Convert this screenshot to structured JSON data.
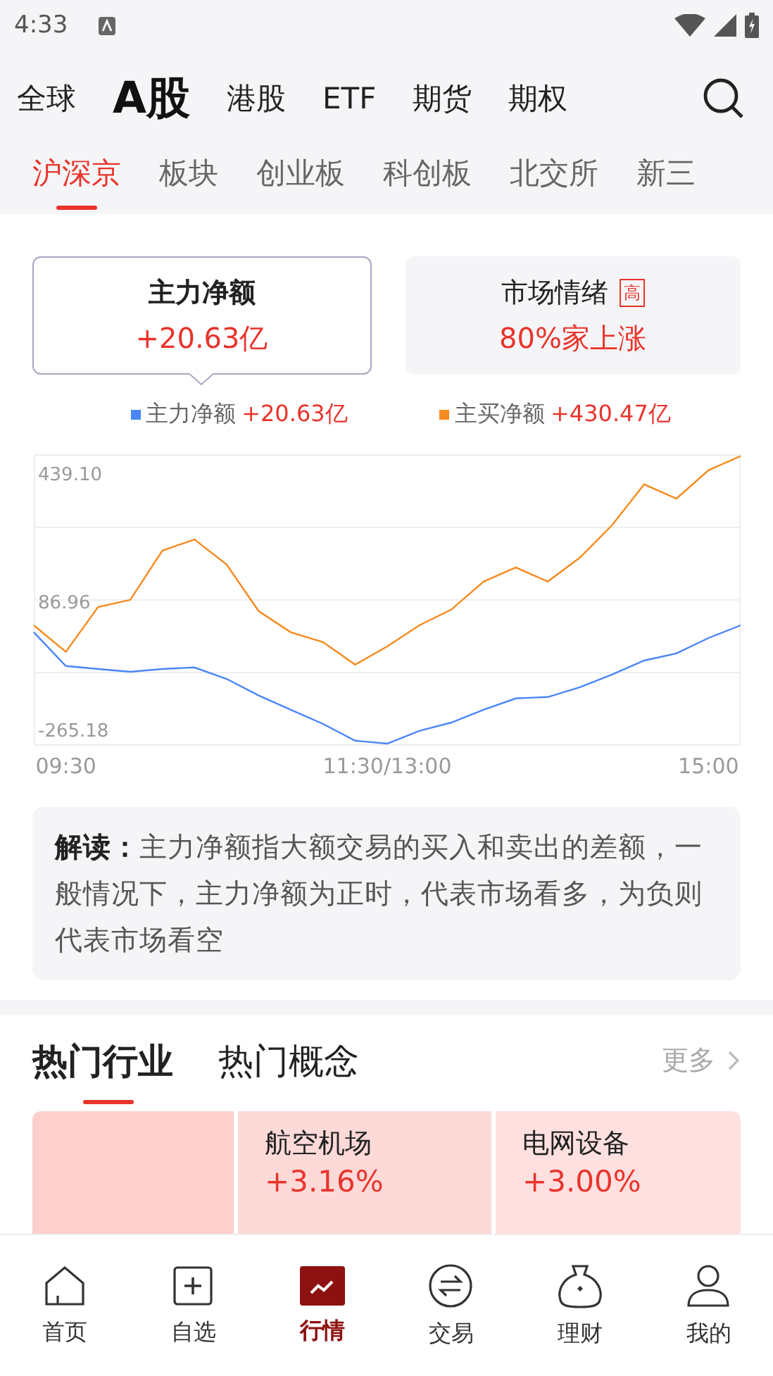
{
  "status_bar": {
    "time": "4:33"
  },
  "market_tabs": [
    {
      "label": "全球",
      "selected": false
    },
    {
      "label": "A股",
      "selected": true
    },
    {
      "label": "港股",
      "selected": false
    },
    {
      "label": "ETF",
      "selected": false
    },
    {
      "label": "期货",
      "selected": false
    },
    {
      "label": "期权",
      "selected": false
    }
  ],
  "sub_tabs": [
    {
      "label": "沪深京",
      "selected": true
    },
    {
      "label": "板块",
      "selected": false
    },
    {
      "label": "创业板",
      "selected": false
    },
    {
      "label": "科创板",
      "selected": false
    },
    {
      "label": "北交所",
      "selected": false
    },
    {
      "label": "新三",
      "selected": false
    }
  ],
  "overview_cards": [
    {
      "title": "主力净额",
      "value": "+20.63亿",
      "selected": true
    },
    {
      "title": "市场情绪",
      "badge": "高",
      "value": "80%家上涨",
      "selected": false
    }
  ],
  "legend_values": [
    "+20.63亿",
    "+430.47亿"
  ],
  "chart_data": {
    "type": "line",
    "categories": [
      null,
      "09:30",
      null,
      null,
      null,
      null,
      null,
      null,
      null,
      null,
      null,
      "11:30/13:00",
      null,
      null,
      null,
      null,
      null,
      null,
      null,
      null,
      null,
      "15:00",
      null
    ],
    "series": [
      {
        "name": "主力净额",
        "color": "#4a86f7",
        "values": [
          2,
          -91,
          -99,
          -107,
          -99,
          -95,
          -126,
          -172,
          -211,
          -250,
          -296,
          -304,
          -269,
          -246,
          -211,
          -180,
          -176,
          -149,
          -114,
          -76,
          -56,
          -14,
          21
        ]
      },
      {
        "name": "主买净额",
        "color": "#f68a1e",
        "values": [
          21,
          -52,
          71,
          91,
          226,
          257,
          188,
          60,
          2,
          -25,
          -87,
          -37,
          21,
          64,
          141,
          180,
          141,
          207,
          296,
          408,
          369,
          447,
          486
        ]
      }
    ],
    "ylim": [
      -308,
      489
    ],
    "yticks": [
      {
        "value": 439.1,
        "label": "439.10"
      },
      {
        "value": 86.96,
        "label": "86.96"
      },
      {
        "value": -265.18,
        "label": "-265.18"
      }
    ]
  },
  "note": "**解读：**主力净额指大额交易的买入和卖出的差额，一般情况下，主力净额为正时，代表市场看多，为负则代表市场看空",
  "hot_tabs": [
    {
      "label": "热门行业",
      "selected": true
    },
    {
      "label": "热门概念",
      "selected": false
    }
  ],
  "more": "更多",
  "hot_tiles": [
    {
      "kind": "blank"
    },
    {
      "kind": "sector",
      "name": "航空机场",
      "change": "+3.16%"
    },
    {
      "kind": "sector",
      "name": "电网设备",
      "change": "+3.00%"
    }
  ],
  "bottom_nav": [
    {
      "label": "首页",
      "selected": false
    },
    {
      "label": "自选",
      "selected": false
    },
    {
      "label": "行情",
      "selected": true
    },
    {
      "label": "交易",
      "selected": false
    },
    {
      "label": "理财",
      "selected": false
    },
    {
      "label": "我的",
      "selected": false
    }
  ]
}
